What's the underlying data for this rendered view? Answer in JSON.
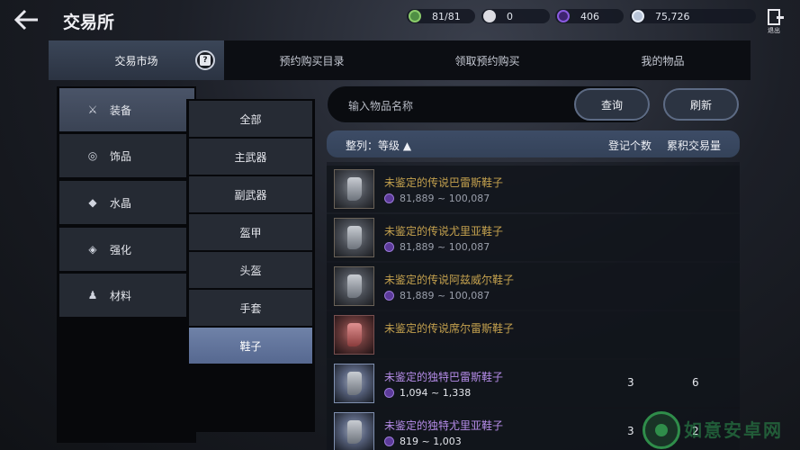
{
  "header": {
    "title": "交易所",
    "currencies": [
      {
        "icon": "green-stamina-icon",
        "value": "81/81",
        "color": "#5aa04a"
      },
      {
        "icon": "white-pearl-icon",
        "value": "0",
        "color": "#e8e8ee"
      },
      {
        "icon": "purple-orb-icon",
        "value": "406",
        "color": "#7a4ad0"
      },
      {
        "icon": "silver-coin-icon",
        "value": "75,726",
        "color": "#b8c4d8"
      }
    ],
    "exit_label": "退出"
  },
  "tabs": [
    {
      "label": "交易市场",
      "active": true
    },
    {
      "label": "预约购买目录",
      "active": false
    },
    {
      "label": "领取预约购买",
      "active": false
    },
    {
      "label": "我的物品",
      "active": false
    }
  ],
  "help_glyph": "?",
  "categories": [
    {
      "label": "装备",
      "icon": "crossed-swords-icon",
      "glyph": "⚔",
      "active": true
    },
    {
      "label": "饰品",
      "icon": "ring-icon",
      "glyph": "◎",
      "active": false
    },
    {
      "label": "水晶",
      "icon": "crystal-icon",
      "glyph": "◆",
      "active": false
    },
    {
      "label": "强化",
      "icon": "enhance-icon",
      "glyph": "◈",
      "active": false
    },
    {
      "label": "材料",
      "icon": "potion-icon",
      "glyph": "♟",
      "active": false
    }
  ],
  "subcategories": [
    {
      "label": "全部",
      "active": false
    },
    {
      "label": "主武器",
      "active": false
    },
    {
      "label": "副武器",
      "active": false
    },
    {
      "label": "盔甲",
      "active": false
    },
    {
      "label": "头盔",
      "active": false
    },
    {
      "label": "手套",
      "active": false
    },
    {
      "label": "鞋子",
      "active": true
    }
  ],
  "search": {
    "placeholder": "输入物品名称",
    "query_button": "查询",
    "refresh_button": "刷新"
  },
  "sort": {
    "label": "整列：等级 ▲",
    "col_registered": "登记个数",
    "col_volume": "累积交易量"
  },
  "items": [
    {
      "name": "未鉴定的传说巴雷斯鞋子",
      "grade": "legend",
      "price": "81,889 ~ 100,087",
      "registered": "",
      "volume": ""
    },
    {
      "name": "未鉴定的传说尤里亚鞋子",
      "grade": "legend",
      "price": "81,889 ~ 100,087",
      "registered": "",
      "volume": ""
    },
    {
      "name": "未鉴定的传说阿兹威尔鞋子",
      "grade": "legend",
      "price": "81,889 ~ 100,087",
      "registered": "",
      "volume": ""
    },
    {
      "name": "未鉴定的传说席尔雷斯鞋子",
      "grade": "legend-red",
      "price": "",
      "registered": "",
      "volume": ""
    },
    {
      "name": "未鉴定的独特巴雷斯鞋子",
      "grade": "unique",
      "price": "1,094 ~ 1,338",
      "registered": "3",
      "volume": "6"
    },
    {
      "name": "未鉴定的独特尤里亚鞋子",
      "grade": "unique",
      "price": "819 ~ 1,003",
      "registered": "3",
      "volume": "2"
    }
  ],
  "watermark": {
    "text": "如意安卓网",
    "color": "#2f8d4a"
  }
}
